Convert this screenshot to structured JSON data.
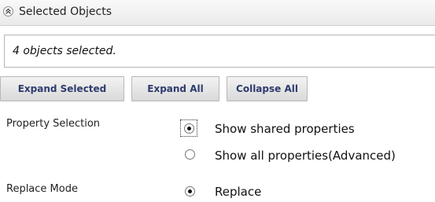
{
  "header": {
    "title": "Selected Objects",
    "toggle_icon": "double-chevron-up-icon"
  },
  "status": {
    "text": "4 objects selected."
  },
  "buttons": {
    "expand_selected": "Expand Selected",
    "expand_all": "Expand All",
    "collapse_all": "Collapse All"
  },
  "property_selection": {
    "label": "Property Selection",
    "options": [
      {
        "label": "Show shared properties",
        "selected": true
      },
      {
        "label": "Show all properties(Advanced)",
        "selected": false
      }
    ]
  },
  "replace_mode": {
    "label": "Replace Mode",
    "options": [
      {
        "label": "Replace",
        "selected": true
      }
    ]
  },
  "colors": {
    "button_text": "#2e3c6e",
    "header_bg": "#eeeeee"
  }
}
